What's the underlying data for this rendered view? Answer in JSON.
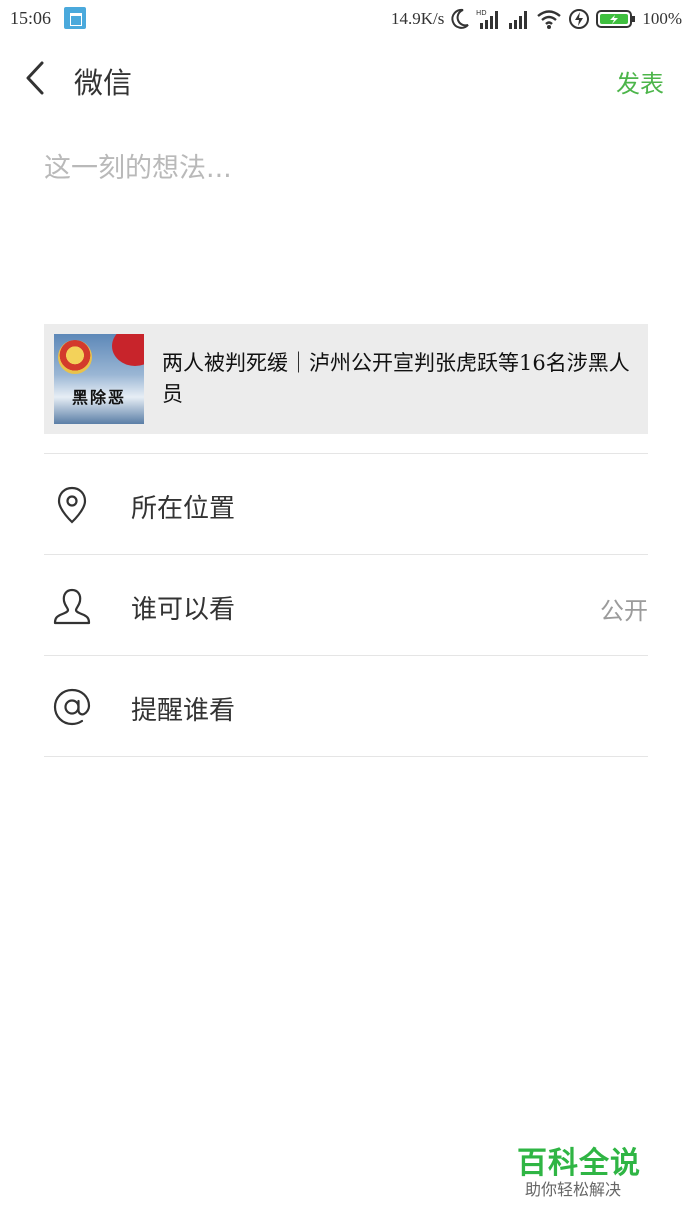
{
  "status_bar": {
    "time": "15:06",
    "network_speed": "14.9K/s",
    "battery": "100%",
    "icons": [
      "app-notification-icon",
      "moon-icon",
      "hd-signal-icon",
      "signal-icon",
      "wifi-icon",
      "charging-icon",
      "battery-icon"
    ]
  },
  "header": {
    "title": "微信",
    "publish_label": "发表",
    "back_icon": "chevron-left-icon"
  },
  "composer": {
    "placeholder": "这一刻的想法..."
  },
  "share_card": {
    "thumb_text": "黑除恶",
    "title": "两人被判死缓｜泸州公开宣判张虎跃等16名涉黑人员"
  },
  "options": [
    {
      "icon": "location-pin-icon",
      "label": "所在位置",
      "value": ""
    },
    {
      "icon": "person-icon",
      "label": "谁可以看",
      "value": "公开"
    },
    {
      "icon": "at-sign-icon",
      "label": "提醒谁看",
      "value": ""
    }
  ],
  "watermark": {
    "title": "百科全说",
    "subtitle": "助你轻松解决"
  },
  "colors": {
    "accent": "#4cb54a",
    "card_background": "#ececec",
    "divider": "#e5e5e5"
  }
}
